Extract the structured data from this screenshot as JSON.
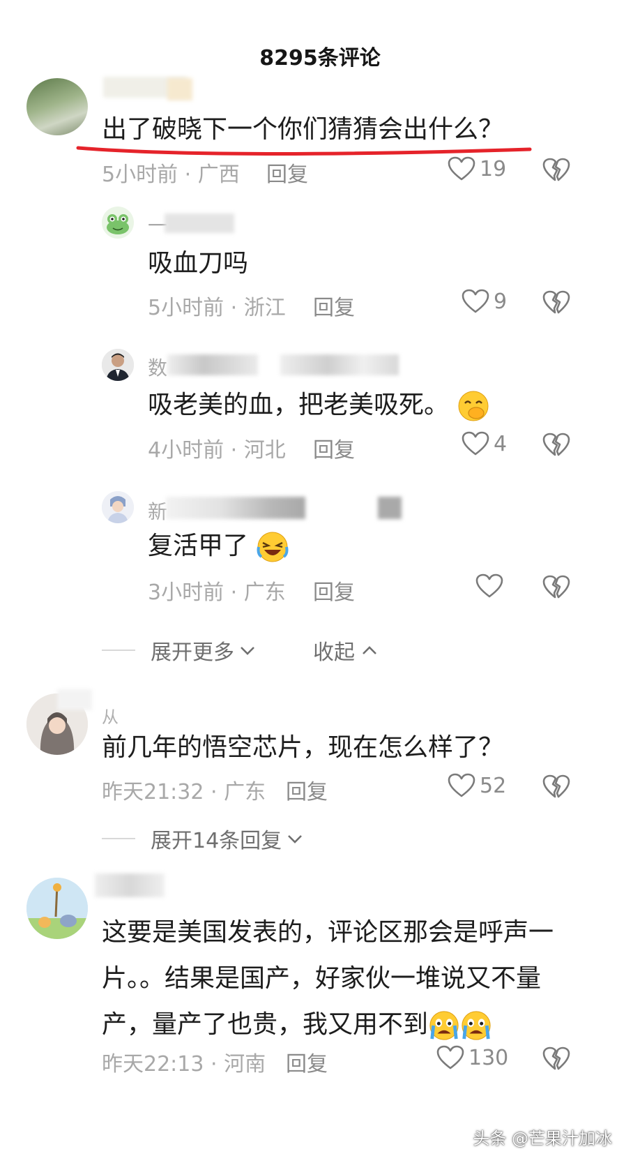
{
  "header": {
    "title": "8295条评论"
  },
  "comments": [
    {
      "text": "出了破晓下一个你们猜猜会出什么？",
      "time_loc": "5小时前 · 广西",
      "reply": "回复",
      "likes": "19"
    },
    {
      "name_prefix": "一",
      "text": "吸血刀吗",
      "time_loc": "5小时前 · 浙江",
      "reply": "回复",
      "likes": "9"
    },
    {
      "name_prefix": "数",
      "text": "吸老美的血，把老美吸死。",
      "time_loc": "4小时前 · 河北",
      "reply": "回复",
      "likes": "4"
    },
    {
      "name_prefix": "新",
      "text": "复活甲了",
      "time_loc": "3小时前 · 广东",
      "reply": "回复",
      "likes": ""
    },
    {
      "name_prefix": "从",
      "text": "前几年的悟空芯片，现在怎么样了？",
      "time_loc": "昨天21:32 · 广东",
      "reply": "回复",
      "likes": "52"
    },
    {
      "text": "这要是美国发表的，评论区那会是呼声一片。。结果是国产，好家伙一堆说又不量产，量产了也贵，我又用不到",
      "time_loc": "昨天22:13 · 河南",
      "reply": "回复",
      "likes": "130"
    }
  ],
  "expand": {
    "more": "展开更多",
    "collapse": "收起",
    "more_replies": "展开14条回复"
  },
  "watermark": "头条 @芒果汁加冰",
  "colors": {
    "underline": "#e5232a",
    "icon": "#7a7a7a",
    "meta": "#a8a8a8"
  },
  "icons": [
    "heart-icon",
    "broken-heart-icon",
    "chevron-down-icon",
    "chevron-up-icon",
    "smile-cover-mouth-emoji",
    "laugh-cry-emoji",
    "crying-emoji"
  ]
}
